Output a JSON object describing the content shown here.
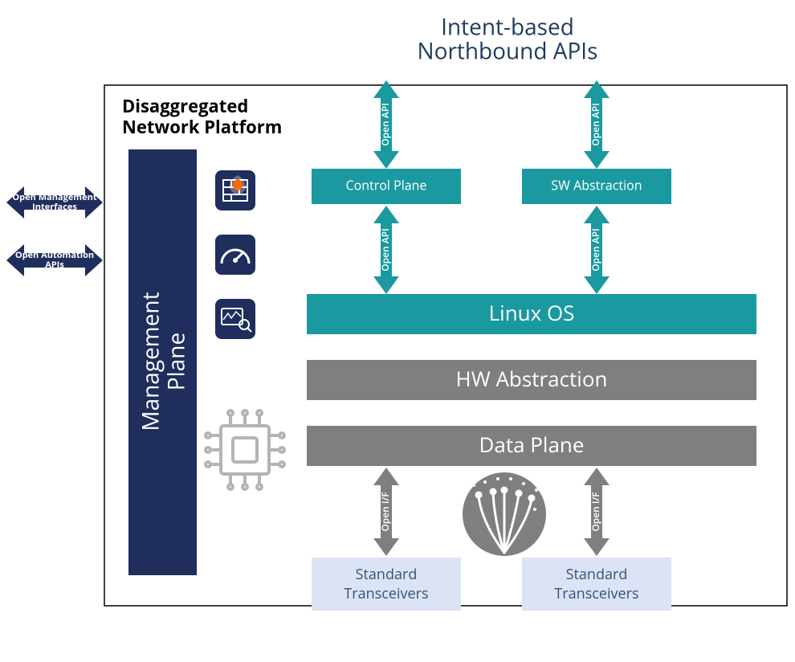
{
  "title_line1": "Intent-based",
  "title_line2": "Northbound APIs",
  "platform_title_line1": "Disaggregated",
  "platform_title_line2": "Network Platform",
  "mgmt_plane_line1": "Management",
  "mgmt_plane_line2": "Plane",
  "ext_mgmt_line1": "Open Management",
  "ext_mgmt_line2": "Interfaces",
  "ext_auto_line1": "Open Automation",
  "ext_auto_line2": "APIs",
  "control_plane": "Control Plane",
  "sw_abstraction": "SW Abstraction",
  "linux_os": "Linux OS",
  "hw_abstraction": "HW Abstraction",
  "data_plane": "Data Plane",
  "transceivers_line1": "Standard",
  "transceivers_line2": "Transceivers",
  "open_api": "Open API",
  "open_if": "Open I/F",
  "colors": {
    "navy": "#1f2e5c",
    "teal": "#1a9aa0",
    "gray": "#7f7f7f",
    "lightblue": "#dbe3f5",
    "border": "#000"
  },
  "icons": [
    "firewall-icon",
    "gauge-icon",
    "monitor-icon",
    "chip-icon",
    "fiber-icon"
  ]
}
